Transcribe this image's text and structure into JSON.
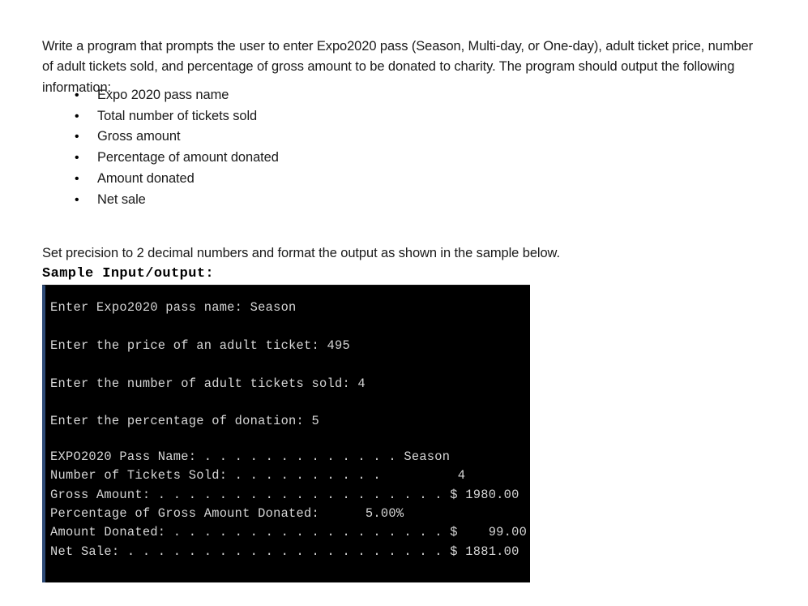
{
  "document": {
    "intro_paragraph": "Write a program that prompts the user to enter Expo2020 pass (Season, Multi-day, or One-day), adult ticket price, number of adult tickets sold, and percentage of gross amount to be donated to charity. The program should output the following information:",
    "bullet_marker": "•",
    "output_items": [
      "Expo 2020 pass name",
      "Total number of tickets sold",
      "Gross amount",
      "Percentage of amount donated",
      "Amount donated",
      "Net sale"
    ],
    "precision_note": "Set precision to 2 decimal numbers and format the output as shown in the sample below.",
    "sample_heading": "Sample Input/output:"
  },
  "console": {
    "background_color": "#000000",
    "text_color": "#d6d6d6",
    "border_color": "#2e4a76",
    "input_lines": [
      "Enter Expo2020 pass name: Season",
      "Enter the price of an adult ticket: 495",
      "Enter the number of adult tickets sold: 4",
      "Enter the percentage of donation: 5"
    ],
    "prompts": [
      {
        "label": "Enter Expo2020 pass name:",
        "value": "Season"
      },
      {
        "label": "Enter the price of an adult ticket:",
        "value": "495"
      },
      {
        "label": "Enter the number of adult tickets sold:",
        "value": "4"
      },
      {
        "label": "Enter the percentage of donation:",
        "value": "5"
      }
    ],
    "report_rows": [
      {
        "label": "EXPO2020 Pass Name:",
        "leader": ". . . . . . . . . . . . .",
        "value": "Season"
      },
      {
        "label": "Number of Tickets Sold:",
        "leader": ". . . . . . . . . .",
        "value": "4"
      },
      {
        "label": "Gross Amount:",
        "leader": ". . . . . . . . . . . . . . . . . . .",
        "value": "$ 1980.00"
      },
      {
        "label": "Percentage of Gross Amount Donated:",
        "leader": "",
        "value": "5.00%"
      },
      {
        "label": "Amount Donated:",
        "leader": ". . . . . . . . . . . . . . . . . .",
        "value": "$    99.00"
      },
      {
        "label": "Net Sale:",
        "leader": ". . . . . . . . . . . . . . . . . . . . .",
        "value": "$ 1881.00"
      }
    ],
    "report_text": "EXPO2020 Pass Name: . . . . . . . . . . . . . Season\nNumber of Tickets Sold: . . . . . . . . . .          4\nGross Amount: . . . . . . . . . . . . . . . . . . . $ 1980.00\nPercentage of Gross Amount Donated:      5.00%\nAmount Donated: . . . . . . . . . . . . . . . . . . $    99.00\nNet Sale: . . . . . . . . . . . . . . . . . . . . . $ 1881.00"
  }
}
